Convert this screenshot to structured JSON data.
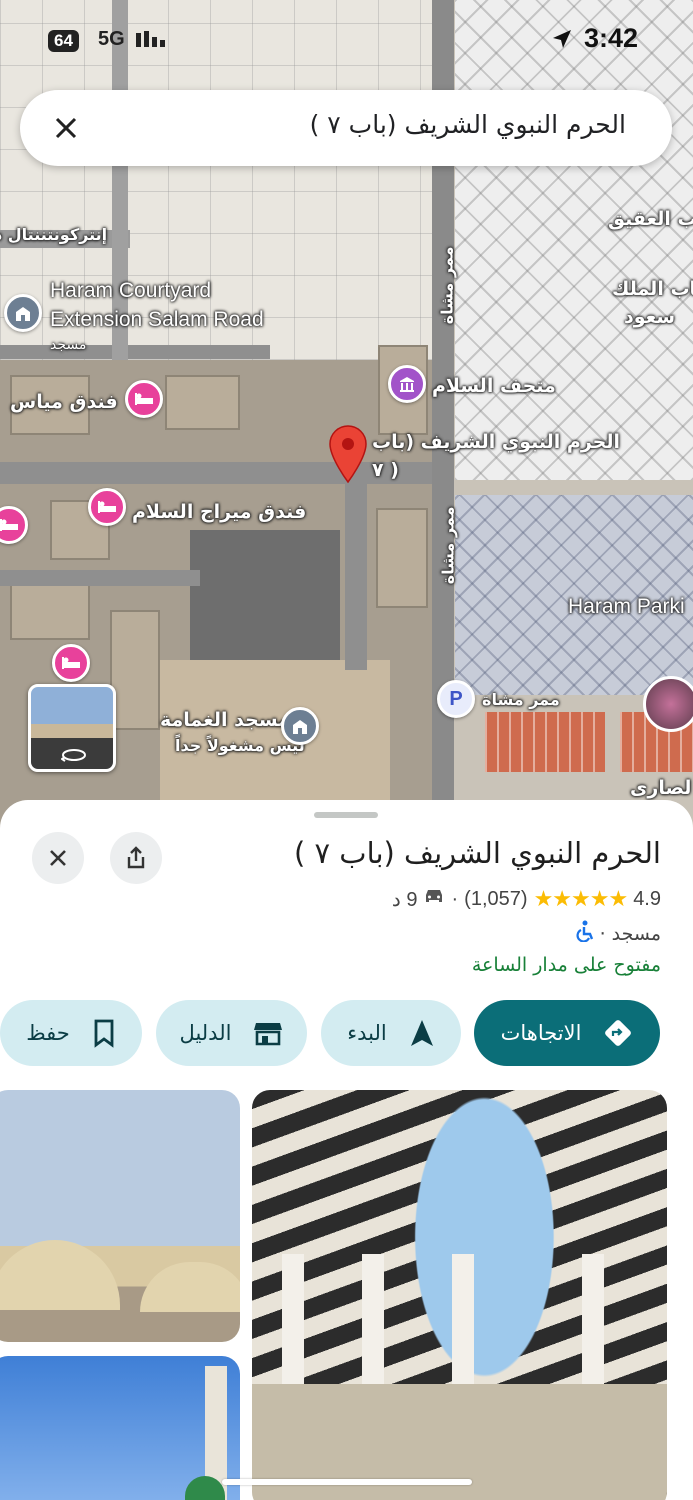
{
  "status_bar": {
    "badge": "64",
    "network": "5G",
    "time": "3:42"
  },
  "search": {
    "query": "الحرم النبوي الشريف (باب ٧ )"
  },
  "map": {
    "labels": {
      "intercontinental": "إنتركونتننتال د",
      "courtyard_1": "Haram Courtyard",
      "courtyard_2": "Extension Salam Road",
      "courtyard_cat": "مسجد",
      "mayas_hotel": "فندق مياس",
      "museum": "متحف السلام",
      "pin_label_1": "الحرم النبوي الشريف (باب",
      "pin_label_2": "٧ )",
      "meraj_hotel": "فندق ميراج السلام",
      "aqiq_gate": "باب العقيق",
      "king_saud_1": "باب الملك",
      "king_saud_2": "سعود",
      "walkway_top": "ممر مشاة",
      "walkway_mid": "ممر مشاة",
      "walkway_bottom": "ممر مشاة",
      "haram_parking": "Haram Parki",
      "ghamama_1": "مسجد الغمامة",
      "ghamama_2": "ليس مشغولاً جداً",
      "ansari": "لصارى",
      "parking_letter": "P"
    }
  },
  "place": {
    "title": "الحرم النبوي الشريف (باب ٧ )",
    "rating": "4.9",
    "stars": "★★★★★",
    "reviews": "(1,057)",
    "separator": "·",
    "drive_time": "9 د",
    "category": "مسجد",
    "hours": "مفتوح على مدار الساعة"
  },
  "actions": {
    "directions": "الاتجاهات",
    "start": "البدء",
    "directory": "الدليل",
    "save": "حفظ"
  },
  "colors": {
    "primary": "#0b6e78",
    "secondary": "#d3ecf1",
    "open": "#188038",
    "star": "#fbbc04",
    "pin": "#ea4335"
  }
}
